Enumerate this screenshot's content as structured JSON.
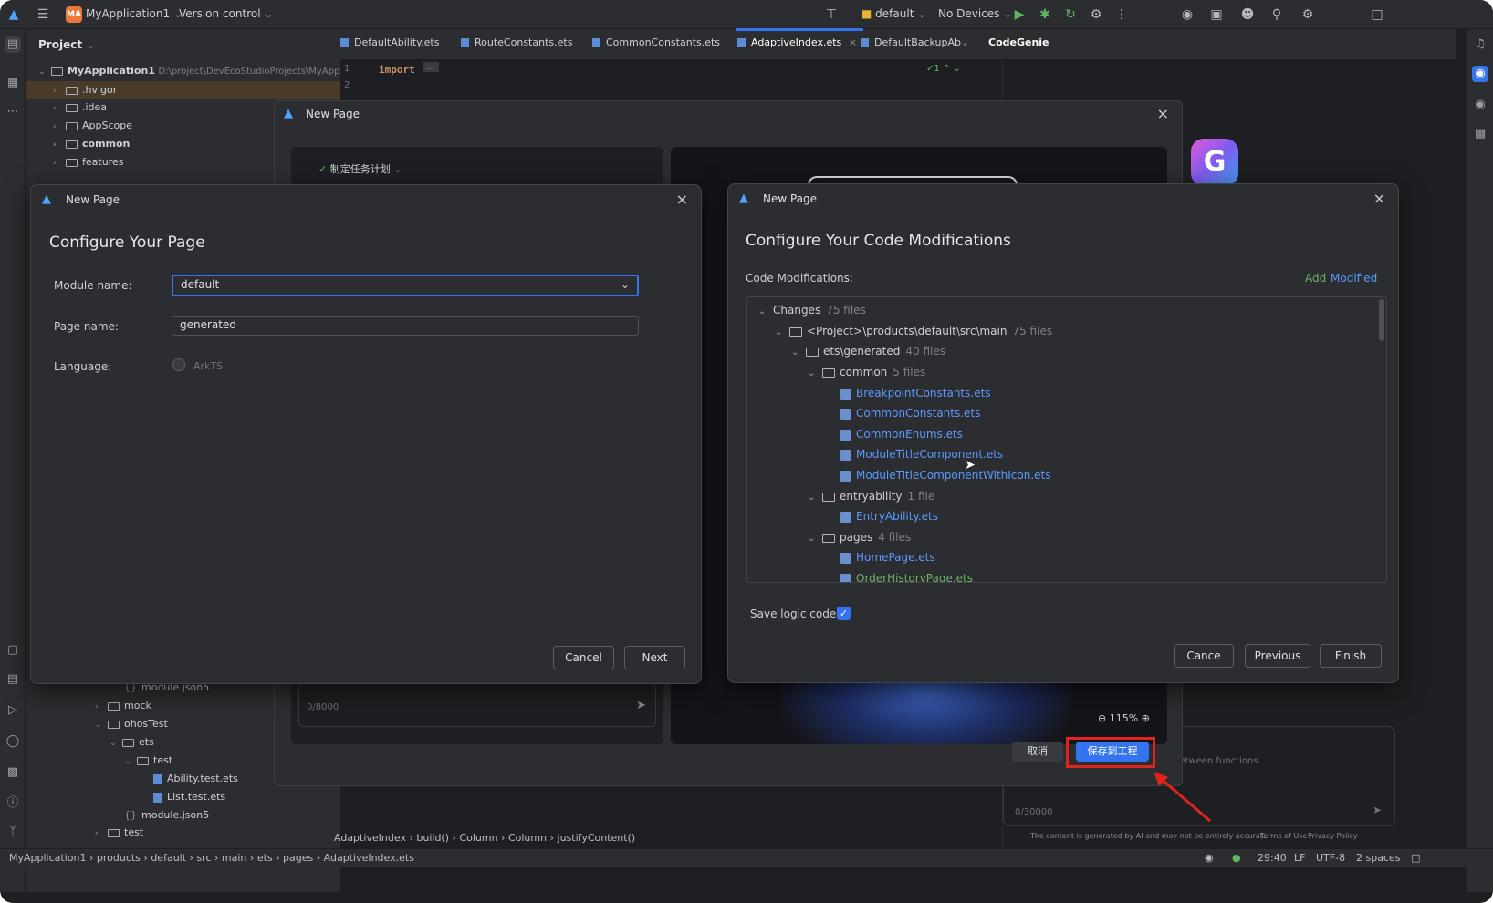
{
  "titlebar": {
    "project_badge": "MA",
    "project_name": "MyApplication1",
    "version_control": "Version control",
    "device_config": "default",
    "devices": "No Devices"
  },
  "project_panel": {
    "header": "Project",
    "root_name": "MyApplication1",
    "root_path": "D:\\project\\DevEcoStudioProjects\\MyAppl",
    "top_items": [
      ".hvigor",
      ".idea",
      "AppScope",
      "common",
      "features"
    ],
    "bottom_items": [
      "module.json5",
      "mock",
      "ohosTest",
      "ets",
      "test",
      "Ability.test.ets",
      "List.test.ets",
      "module.json5",
      "test"
    ]
  },
  "tabs": [
    {
      "label": "DefaultAbility.ets"
    },
    {
      "label": "RouteConstants.ets"
    },
    {
      "label": "CommonConstants.ets"
    },
    {
      "label": "AdaptiveIndex.ets"
    },
    {
      "label": "DefaultBackupAb"
    }
  ],
  "codegenie_label": "CodeGenie",
  "editor": {
    "line1": "1",
    "line2": "2",
    "code": "import",
    "fold": "...",
    "inspection": "1"
  },
  "back_dialog": {
    "title": "New Page",
    "plan_label": "制定任务计划",
    "char_count": "0/8000",
    "zoom": "115%",
    "cancel": "取消",
    "save": "保存到工程"
  },
  "genie": {
    "hint": "between functions.",
    "count": "0/30000",
    "disclaimer": "The content is generated by AI and may not be entirely accurat...",
    "terms": "Terms of Use",
    "privacy": "Privacy Policy"
  },
  "left_dialog": {
    "title": "New Page",
    "heading": "Configure Your Page",
    "module_label": "Module name:",
    "module_value": "default",
    "page_label": "Page name:",
    "page_value": "generated",
    "language_label": "Language:",
    "language_value": "ArkTS",
    "cancel": "Cancel",
    "next": "Next"
  },
  "right_dialog": {
    "title": "New Page",
    "heading": "Configure Your Code Modifications",
    "mods_label": "Code Modifications:",
    "legend_add": "Add",
    "legend_modified": "Modified",
    "tree": {
      "changes": "Changes",
      "changes_count": "75 files",
      "main": "<Project>\\products\\default\\src\\main",
      "main_count": "75 files",
      "generated": "ets\\generated",
      "generated_count": "40 files",
      "common": "common",
      "common_count": "5 files",
      "common_files": [
        "BreakpointConstants.ets",
        "CommonConstants.ets",
        "CommonEnums.ets",
        "ModuleTitleComponent.ets",
        "ModuleTitleComponentWithIcon.ets"
      ],
      "entryability": "entryability",
      "entryability_count": "1 file",
      "entry_file": "EntryAbility.ets",
      "pages": "pages",
      "pages_count": "4 files",
      "page_files": [
        "HomePage.ets",
        "OrderHistoryPage.ets"
      ]
    },
    "save_logic": "Save logic code",
    "cancel": "Cance",
    "previous": "Previous",
    "finish": "Finish"
  },
  "breadcrumbs": [
    "AdaptiveIndex",
    "build()",
    "Column",
    "Column",
    "justifyContent()"
  ],
  "statusbar": {
    "path": [
      "MyApplication1",
      "products",
      "default",
      "src",
      "main",
      "ets",
      "pages",
      "AdaptiveIndex.ets"
    ],
    "position": "29:40",
    "line_ending": "LF",
    "encoding": "UTF-8",
    "indent": "2 spaces"
  },
  "colors": {
    "accent": "#3574f0",
    "add_green": "#6fb26b",
    "link_blue": "#5c9aff",
    "highlight_red": "#e0241b"
  }
}
